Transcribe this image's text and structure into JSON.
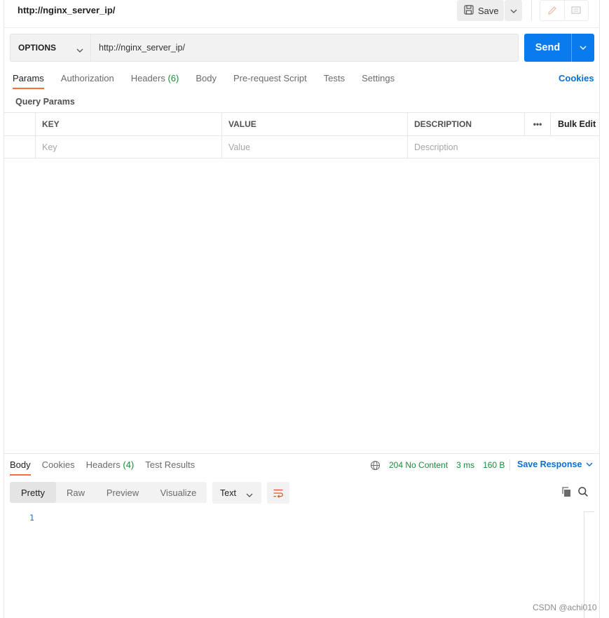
{
  "request": {
    "title": "http://nginx_server_ip/",
    "method": "OPTIONS",
    "url": "http://nginx_server_ip/"
  },
  "toolbar": {
    "save_label": "Save",
    "send_label": "Send"
  },
  "tabs": [
    {
      "label": "Params",
      "count": ""
    },
    {
      "label": "Authorization",
      "count": ""
    },
    {
      "label": "Headers",
      "count": "(6)"
    },
    {
      "label": "Body",
      "count": ""
    },
    {
      "label": "Pre-request Script",
      "count": ""
    },
    {
      "label": "Tests",
      "count": ""
    },
    {
      "label": "Settings",
      "count": ""
    }
  ],
  "cookies_link": "Cookies",
  "query_params": {
    "title": "Query Params",
    "columns": {
      "key": "KEY",
      "value": "VALUE",
      "description": "DESCRIPTION",
      "more": "•••",
      "bulk_edit": "Bulk Edit"
    },
    "placeholders": {
      "key": "Key",
      "value": "Value",
      "description": "Description"
    }
  },
  "response": {
    "tabs": [
      {
        "label": "Body",
        "count": ""
      },
      {
        "label": "Cookies",
        "count": ""
      },
      {
        "label": "Headers",
        "count": "(4)"
      },
      {
        "label": "Test Results",
        "count": ""
      }
    ],
    "status": "204 No Content",
    "time": "3 ms",
    "size": "160 B",
    "save_response": "Save Response",
    "views": [
      "Pretty",
      "Raw",
      "Preview",
      "Visualize"
    ],
    "format": "Text",
    "line_numbers": [
      "1"
    ]
  },
  "watermark": "CSDN @achi010",
  "colors": {
    "accent": "#097bed",
    "active_tab": "#ff6c37",
    "status_ok": "#1c8a3a",
    "link": "#0b6ed1"
  }
}
